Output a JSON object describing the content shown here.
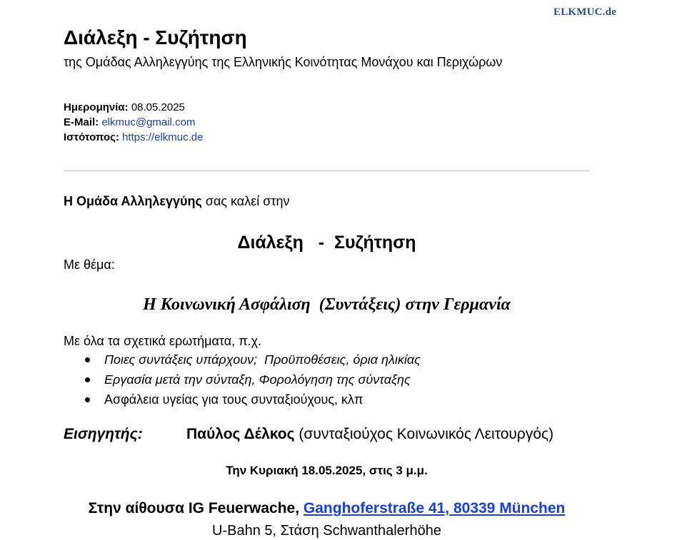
{
  "logo": {
    "text": "ELKMUC.de",
    "color": "#2e4f82"
  },
  "header": {
    "title": "Διάλεξη - Συζήτηση",
    "subtitle": "της Ομάδας Αλληλεγγύης της Ελληνικής Κοινότητας Μονάχου και Περιχώρων"
  },
  "meta": {
    "date_label": "Ημερομηνία:",
    "date_value": "08.05.2025",
    "email_label": "E-Mail:",
    "email_value": "elkmuc@gmail.com",
    "website_label": "Ιστότοπος:",
    "website_value": "https://elkmuc.de"
  },
  "body": {
    "intro_bold": "Η Ομάδα Αλληλεγγύης",
    "intro_rest": " σας καλεί στην",
    "heading": "Διάλεξη   -  Συζήτηση",
    "subject_label": "Με θέμα:",
    "topic": "Η Κοινωνική Ασφάλιση  (Συντάξεις) στην Γερμανία",
    "questions_intro": "Με όλα τα σχετικά ερωτήματα, π.χ.",
    "bullets": [
      "Ποιες συντάξεις υπάρχουν;  Προϋποθέσεις, όρια ηλικίας",
      "Εργασία μετά την σύνταξη, Φορολόγηση της σύνταξης",
      "Ασφάλεια υγείας για τους συνταξιούχους, κλπ"
    ],
    "speaker_label": "Εισηγητής:",
    "speaker_name": "Παύλος Δέλκος",
    "speaker_role": " (συνταξιούχος Κοινωνικός Λειτουργός)",
    "datetime": "Την Κυριακή 18.05.2025, στις 3 μ.μ.",
    "venue_prefix": "Στην αίθουσα IG Feuerwache, ",
    "venue_address": "Ganghoferstraße 41, 80339 München",
    "transit": "U-Bahn 5, Στάση Schwanthalerhöhe"
  },
  "colors": {
    "link_blue": "#1a3fd6",
    "meta_link": "#1f3f8f",
    "divider": "#bdbdbd"
  }
}
